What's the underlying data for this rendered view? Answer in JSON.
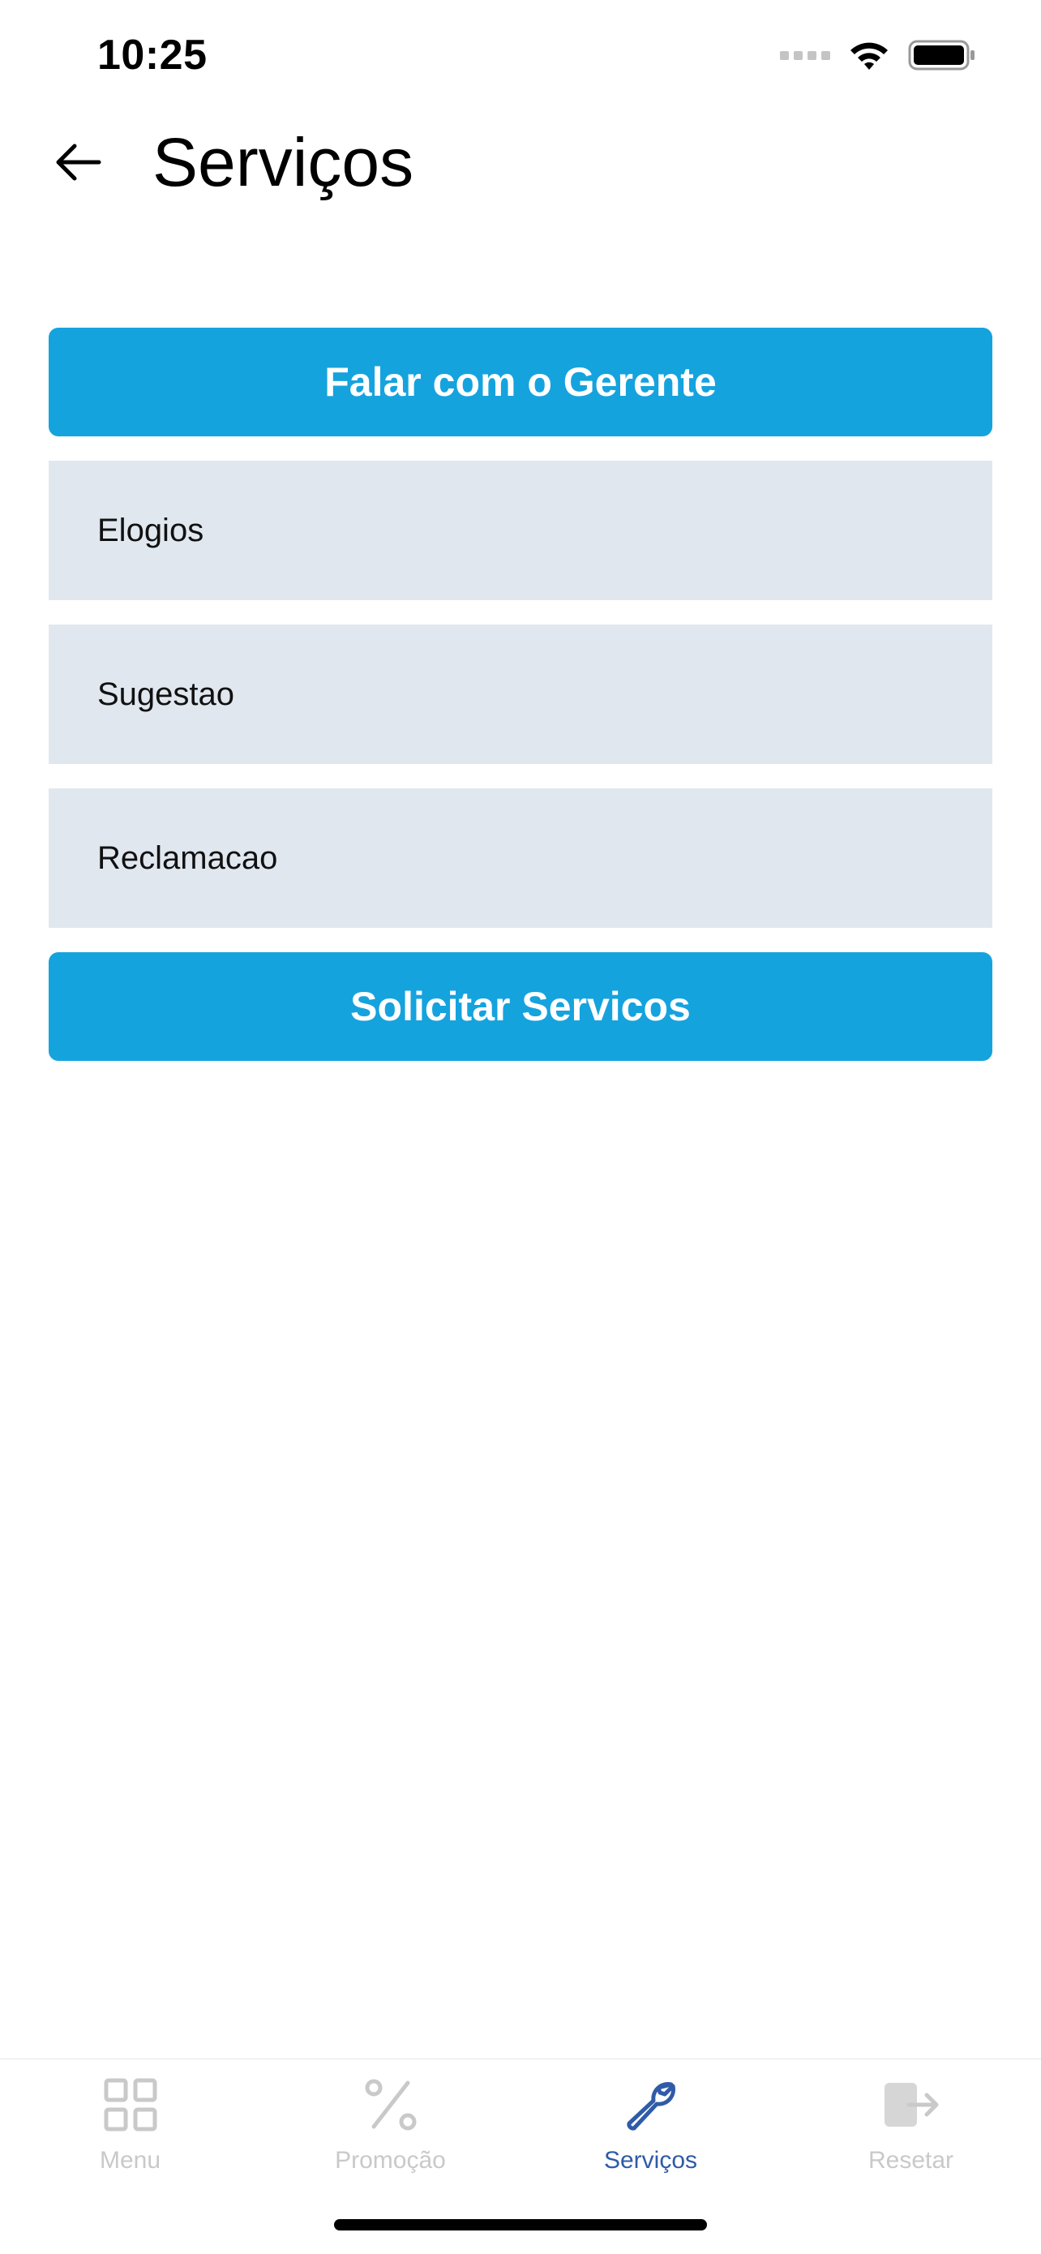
{
  "status_bar": {
    "time": "10:25",
    "icons": [
      "signal-icon",
      "wifi-icon",
      "battery-icon"
    ]
  },
  "header": {
    "back_icon": "arrow-left-icon",
    "title": "Serviços"
  },
  "main": {
    "top_button_label": "Falar com o Gerente",
    "options": [
      {
        "label": "Elogios"
      },
      {
        "label": "Sugestao"
      },
      {
        "label": "Reclamacao"
      }
    ],
    "bottom_button_label": "Solicitar Servicos"
  },
  "tab_bar": {
    "tabs": [
      {
        "label": "Menu",
        "icon": "grid-icon",
        "active": false
      },
      {
        "label": "Promoção",
        "icon": "percent-icon",
        "active": false
      },
      {
        "label": "Serviços",
        "icon": "wrench-icon",
        "active": true
      },
      {
        "label": "Resetar",
        "icon": "logout-icon",
        "active": false
      }
    ]
  },
  "colors": {
    "accent": "#15a3de",
    "option_background": "#e0e7ef",
    "active_tab": "#2f5ba8",
    "inactive_tab": "#c9c9c9"
  }
}
